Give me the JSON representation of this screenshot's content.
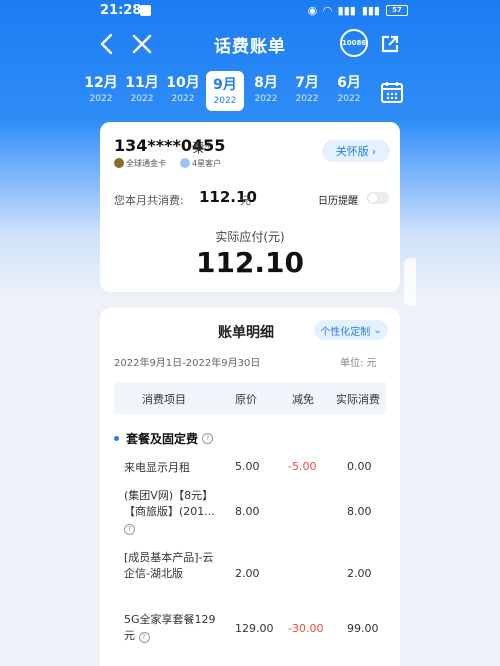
{
  "status_bar": {
    "time": "21:28",
    "battery": "57"
  },
  "nav": {
    "title": "话费账单",
    "service_badge": "10086"
  },
  "months": [
    {
      "month": "12月",
      "year": "2022"
    },
    {
      "month": "11月",
      "year": "2022"
    },
    {
      "month": "10月",
      "year": "2022"
    },
    {
      "month": "9月",
      "year": "2022",
      "active": true
    },
    {
      "month": "8月",
      "year": "2022"
    },
    {
      "month": "7月",
      "year": "2022"
    },
    {
      "month": "6月",
      "year": "2022"
    }
  ],
  "account": {
    "phone": "134****0455",
    "name": "秦*",
    "tag1": "全球通金卡",
    "tag2": "4星客户",
    "care_label": "关怀版"
  },
  "summary": {
    "spend_label": "您本月共消费:",
    "spend_amount": "112.10",
    "spend_unit": "元",
    "calendar_remind": "日历提醒",
    "actual_label": "实际应付(元)",
    "actual_amount": "112.10"
  },
  "detail": {
    "title": "账单明细",
    "custom_label": "个性化定制",
    "period": "2022年9月1日-2022年9月30日",
    "unit": "单位: 元",
    "columns": [
      "消费项目",
      "原价",
      "减免",
      "实际消费"
    ],
    "section_title": "套餐及固定费",
    "rows": [
      {
        "name": "来电显示月租",
        "orig": "5.00",
        "disc": "-5.00",
        "act": "0.00"
      },
      {
        "name": "(集团V网)【8元】【商旅版】(201...",
        "orig": "8.00",
        "disc": "",
        "act": "8.00"
      },
      {
        "name": "[成员基本产品]-云企信-湖北版",
        "orig": "2.00",
        "disc": "",
        "act": "2.00"
      },
      {
        "name": "5G全家享套餐129元",
        "orig": "129.00",
        "disc": "-30.00",
        "act": "99.00"
      }
    ]
  },
  "colors": {
    "primary": "#1f7ff3",
    "discount": "#e84a3f"
  }
}
